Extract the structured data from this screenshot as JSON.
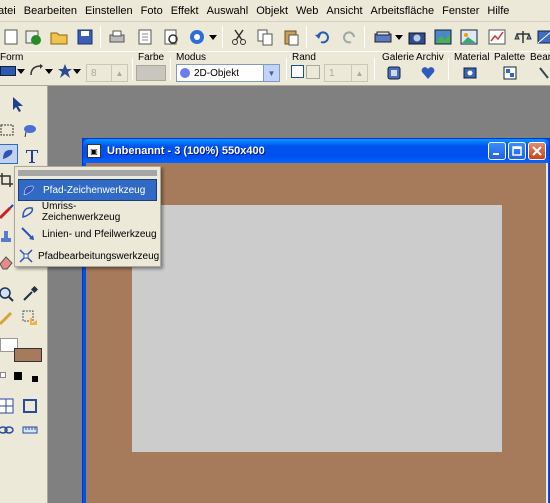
{
  "menu": [
    "atei",
    "Bearbeiten",
    "Einstellen",
    "Foto",
    "Effekt",
    "Auswahl",
    "Objekt",
    "Web",
    "Ansicht",
    "Arbeitsfläche",
    "Fenster",
    "Hilfe"
  ],
  "toolbar2": {
    "form_label": "Form",
    "farbe_label": "Farbe",
    "modus_label": "Modus",
    "modus_value": "2D-Objekt",
    "rand_label": "Rand",
    "width_value": "8",
    "rand_value": "1",
    "galerie_label": "Galerie",
    "archiv_label": "Archiv",
    "material_label": "Material",
    "palette_label": "Palette",
    "bearb_label": "Bearb"
  },
  "document": {
    "title": "Unbenannt - 3 (100%) 550x400",
    "canvas_color": "#a67b5b",
    "inner_color": "#cccccc"
  },
  "flyout": {
    "items": [
      {
        "label": "Pfad-Zeichenwerkzeug",
        "icon": "path-draw-icon"
      },
      {
        "label": "Umriss- Zeichenwerkzeug",
        "icon": "outline-draw-icon"
      },
      {
        "label": "Linien- und Pfeilwerkzeug",
        "icon": "line-arrow-icon"
      },
      {
        "label": "Pfadbearbeitungswerkzeug",
        "icon": "path-edit-icon"
      }
    ]
  },
  "colors": {
    "accent": "#316ac5",
    "foreground_swatch": "#ffffff",
    "background_swatch": "#a67b5b"
  }
}
